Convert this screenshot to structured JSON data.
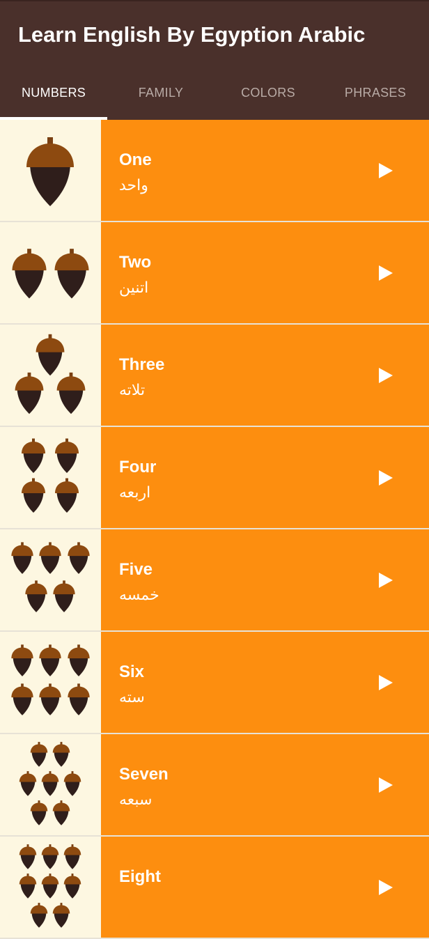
{
  "app": {
    "title": "Learn English By Egyption Arabic"
  },
  "tabs": [
    {
      "label": "NUMBERS",
      "active": true
    },
    {
      "label": "FAMILY",
      "active": false
    },
    {
      "label": "COLORS",
      "active": false
    },
    {
      "label": "PHRASES",
      "active": false
    }
  ],
  "colors": {
    "appbar": "#4a302b",
    "row": "#fd8e0f",
    "image_bg": "#fdf7e1",
    "acorn_cap": "#8d4a10",
    "acorn_nut": "#2f1e1b"
  },
  "items": [
    {
      "english": "One",
      "arabic": "واحد",
      "acorn_count": 1,
      "icon": "acorn-icon",
      "action_icon": "play-icon"
    },
    {
      "english": "Two",
      "arabic": "اتنين",
      "acorn_count": 2,
      "icon": "acorn-icon",
      "action_icon": "play-icon"
    },
    {
      "english": "Three",
      "arabic": "تلاته",
      "acorn_count": 3,
      "icon": "acorn-icon",
      "action_icon": "play-icon"
    },
    {
      "english": "Four",
      "arabic": "اربعه",
      "acorn_count": 4,
      "icon": "acorn-icon",
      "action_icon": "play-icon"
    },
    {
      "english": "Five",
      "arabic": "خمسه",
      "acorn_count": 5,
      "icon": "acorn-icon",
      "action_icon": "play-icon"
    },
    {
      "english": "Six",
      "arabic": "سته",
      "acorn_count": 6,
      "icon": "acorn-icon",
      "action_icon": "play-icon"
    },
    {
      "english": "Seven",
      "arabic": "سبعه",
      "acorn_count": 7,
      "icon": "acorn-icon",
      "action_icon": "play-icon"
    },
    {
      "english": "Eight",
      "arabic": "",
      "acorn_count": 8,
      "icon": "acorn-icon",
      "action_icon": "play-icon"
    }
  ]
}
